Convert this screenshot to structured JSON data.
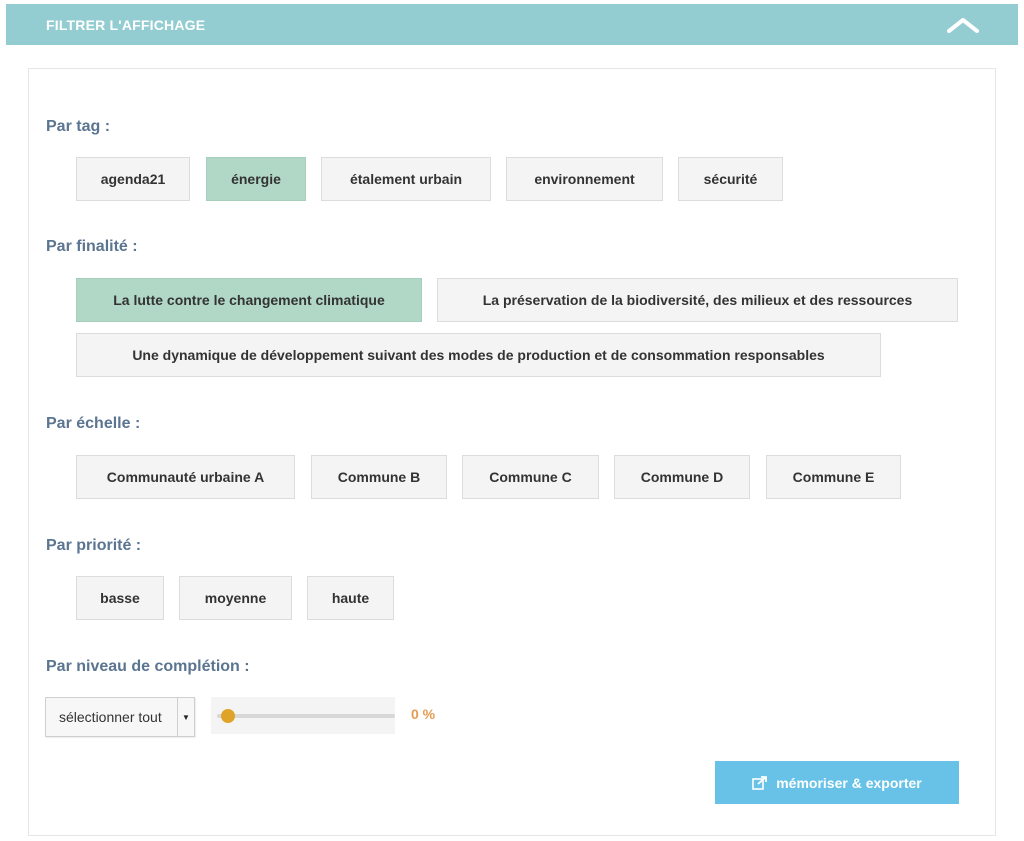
{
  "header": {
    "title": "FILTRER L'AFFICHAGE",
    "toggle_icon": "chevron-up-icon"
  },
  "sections": {
    "tag": {
      "title": "Par tag :",
      "items": [
        {
          "label": "agenda21",
          "active": false
        },
        {
          "label": "énergie",
          "active": true
        },
        {
          "label": "étalement urbain",
          "active": false
        },
        {
          "label": "environnement",
          "active": false
        },
        {
          "label": "sécurité",
          "active": false
        }
      ]
    },
    "finalite": {
      "title": "Par finalité :",
      "items": [
        {
          "label": "La lutte contre le changement climatique",
          "active": true
        },
        {
          "label": "La préservation de la biodiversité, des milieux et des ressources",
          "active": false
        },
        {
          "label": "Une dynamique de développement suivant des modes de production et de consommation responsables",
          "active": false
        }
      ]
    },
    "echelle": {
      "title": "Par échelle :",
      "items": [
        {
          "label": "Communauté urbaine A",
          "active": false
        },
        {
          "label": "Commune B",
          "active": false
        },
        {
          "label": "Commune C",
          "active": false
        },
        {
          "label": "Commune D",
          "active": false
        },
        {
          "label": "Commune E",
          "active": false
        }
      ]
    },
    "priorite": {
      "title": "Par priorité :",
      "items": [
        {
          "label": "basse",
          "active": false
        },
        {
          "label": "moyenne",
          "active": false
        },
        {
          "label": "haute",
          "active": false
        }
      ]
    },
    "completion": {
      "title": "Par niveau de complétion :",
      "select_value": "sélectionner tout",
      "slider_value": 0,
      "slider_display": "0 %"
    }
  },
  "export": {
    "label": "mémoriser & exporter",
    "icon": "share-export-icon"
  },
  "colors": {
    "header_bg": "#93cdd2",
    "active_chip": "#b1d8c6",
    "section_title": "#5b7591",
    "slider_thumb": "#e0a32a",
    "slider_value": "#e59b52",
    "export_bg": "#68c2e8"
  }
}
